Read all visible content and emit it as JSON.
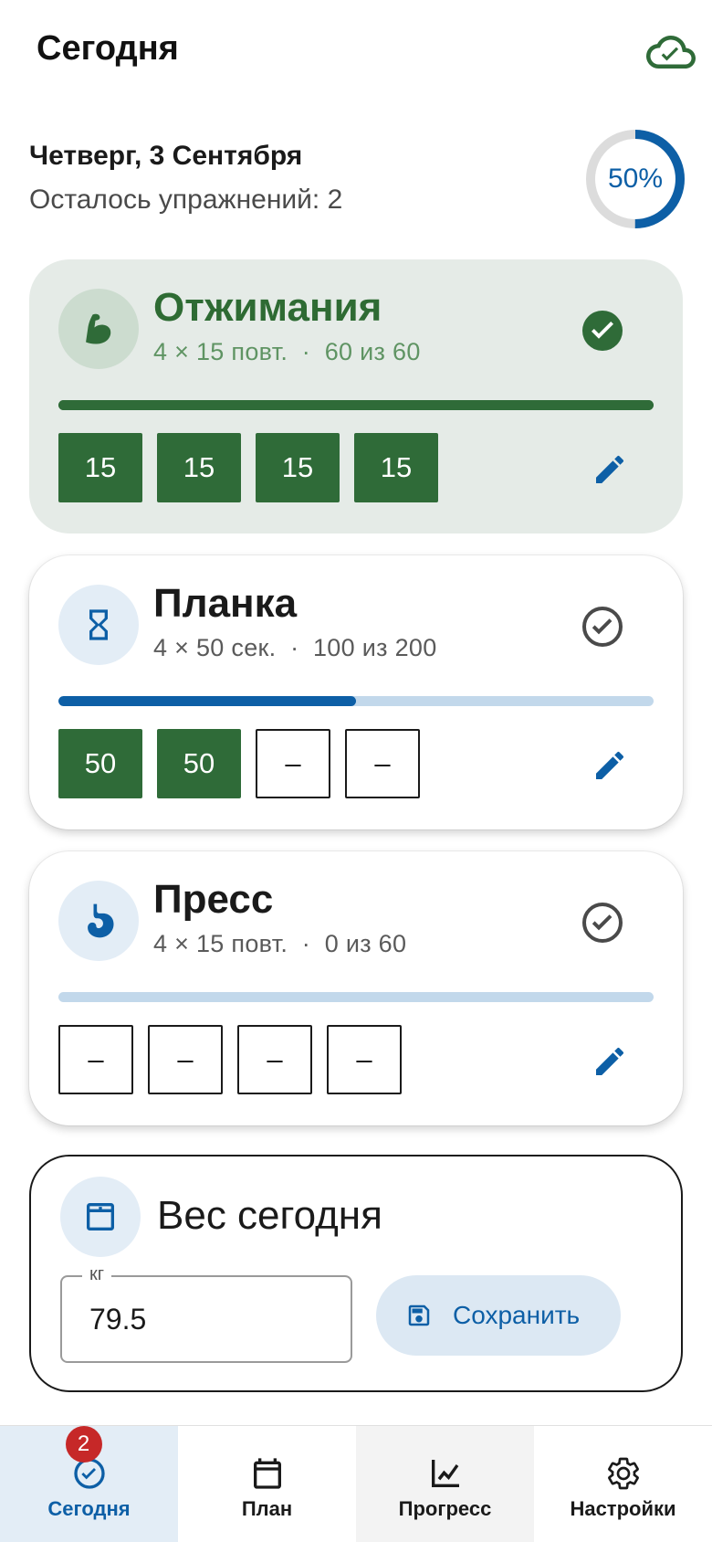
{
  "header": {
    "title": "Сегодня",
    "sync_icon": "cloud-done-icon"
  },
  "summary": {
    "date": "Четверг, 3 Сентября",
    "remaining": "Осталось упражнений: 2",
    "progress_label": "50%",
    "progress_fraction": 0.5
  },
  "exercises": [
    {
      "name": "Отжимания",
      "meta": "4 × 15 повт.",
      "count": "60 из 60",
      "progress": 1.0,
      "icon": "arm-muscle-icon",
      "completed": true,
      "sets": [
        "15",
        "15",
        "15",
        "15"
      ]
    },
    {
      "name": "Планка",
      "meta": "4 × 50 сек.",
      "count": "100 из 200",
      "progress": 0.5,
      "icon": "hourglass-icon",
      "completed": false,
      "sets": [
        "50",
        "50",
        "–",
        "–"
      ]
    },
    {
      "name": "Пресс",
      "meta": "4 × 15 повт.",
      "count": "0 из 60",
      "progress": 0.0,
      "icon": "stomach-icon",
      "completed": false,
      "sets": [
        "–",
        "–",
        "–",
        "–"
      ]
    }
  ],
  "separator": "·",
  "weight": {
    "title": "Вес сегодня",
    "unit_label": "кг",
    "value": "79.5",
    "save_label": "Сохранить"
  },
  "nav": {
    "today": {
      "label": "Сегодня",
      "badge": "2"
    },
    "plan": {
      "label": "План"
    },
    "progress": {
      "label": "Прогресс"
    },
    "settings": {
      "label": "Настройки"
    }
  },
  "colors": {
    "accent": "#0d5fa6",
    "done_green": "#2f6b38",
    "done_bg": "#e5ebe7",
    "track": "#c2d8eb"
  }
}
